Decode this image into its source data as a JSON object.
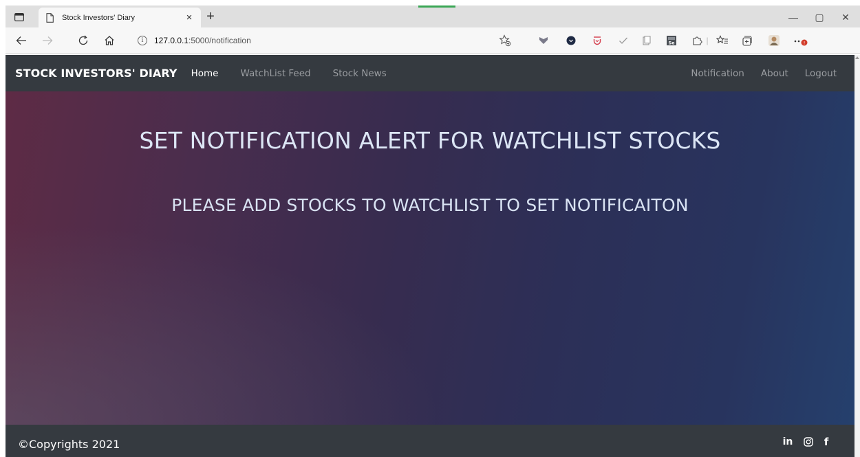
{
  "browser": {
    "tab_title": "Stock Investors' Diary",
    "tab_close": "×",
    "new_tab": "+",
    "url_host": "127.0.0.1",
    "url_rest": ":5000/notification",
    "info_glyph": "i",
    "minimize": "—",
    "restore": "▢",
    "close": "✕"
  },
  "navbar": {
    "brand": "STOCK INVESTORS' DIARY",
    "left_links": [
      "Home",
      "WatchList Feed",
      "Stock News"
    ],
    "right_links": [
      "Notification",
      "About",
      "Logout"
    ],
    "active": "Home"
  },
  "hero": {
    "title": "SET NOTIFICATION ALERT FOR WATCHLIST STOCKS",
    "message": "PLEASE ADD STOCKS TO WATCHLIST TO SET NOTIFICAITON"
  },
  "footer": {
    "copyright": "©Copyrights 2021",
    "social": [
      {
        "icon": "linkedin-icon",
        "glyph": "in"
      },
      {
        "icon": "instagram-icon",
        "glyph": ""
      },
      {
        "icon": "facebook-icon",
        "glyph": "f"
      }
    ]
  },
  "colors": {
    "navbar_bg": "#353a40",
    "hero_left": "#5e2b45",
    "hero_right": "#25406d",
    "heading_text": "#dce6f5"
  }
}
